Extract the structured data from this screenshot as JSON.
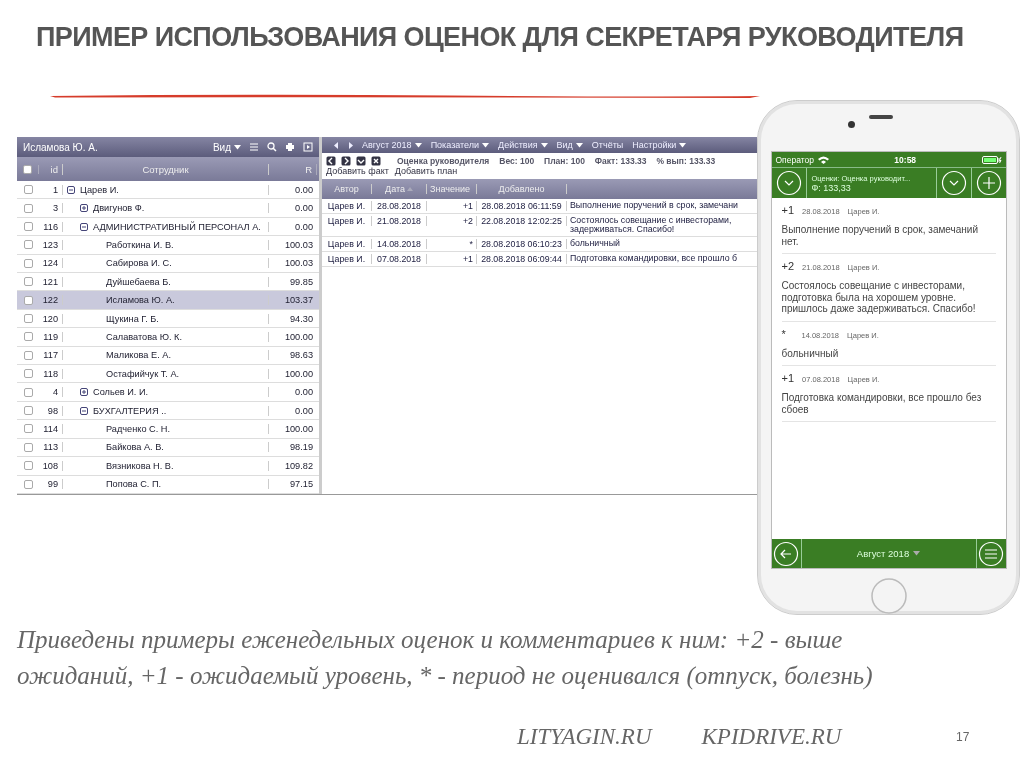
{
  "slide": {
    "title": "ПРИМЕР ИСПОЛЬЗОВАНИЯ ОЦЕНОК ДЛЯ СЕКРЕТАРЯ РУКОВОДИТЕЛЯ",
    "caption": "Приведены примеры еженедельных оценок и комментариев к ним: +2 - выше ожиданий, +1 - ожидаемый уровень, * - период не оценивался (отпуск, болезнь)",
    "footer_links": [
      "LITYAGIN.RU",
      "KPIDRIVE.RU"
    ],
    "page_number": "17"
  },
  "employee_panel": {
    "title": "Исламова Ю. А.",
    "view_menu": "Вид",
    "columns": [
      "id",
      "Сотрудник",
      "R"
    ],
    "all_checked": false,
    "rows": [
      {
        "id": "1",
        "name": "Царев И.",
        "r": "0.00",
        "checked": false,
        "selected": false,
        "expanded": true,
        "children": [
          {
            "id": "3",
            "name": "Двигунов Ф.",
            "r": "0.00",
            "checked": false,
            "selected": false,
            "expanded": false
          },
          {
            "id": "116",
            "name": "АДМИНИСТРАТИВНЫЙ ПЕРСОНАЛ А.",
            "r": "0.00",
            "checked": false,
            "selected": false,
            "expanded": true,
            "children": [
              {
                "id": "123",
                "name": "Работкина И. В.",
                "r": "100.03",
                "checked": false,
                "selected": false
              },
              {
                "id": "124",
                "name": "Сабирова И. С.",
                "r": "100.03",
                "checked": false,
                "selected": false
              },
              {
                "id": "121",
                "name": "Дуйшебаева Б.",
                "r": "99.85",
                "checked": false,
                "selected": false
              },
              {
                "id": "122",
                "name": "Исламова Ю. А.",
                "r": "103.37",
                "checked": false,
                "selected": true
              },
              {
                "id": "120",
                "name": "Щукина Г. Б.",
                "r": "94.30",
                "checked": false,
                "selected": false
              },
              {
                "id": "119",
                "name": "Салаватова Ю. К.",
                "r": "100.00",
                "checked": false,
                "selected": false
              },
              {
                "id": "117",
                "name": "Маликова Е. А.",
                "r": "98.63",
                "checked": false,
                "selected": false
              },
              {
                "id": "118",
                "name": "Остафийчук Т. А.",
                "r": "100.00",
                "checked": false,
                "selected": false
              }
            ]
          },
          {
            "id": "4",
            "name": "Сольев И. И.",
            "r": "0.00",
            "checked": false,
            "selected": false,
            "expanded": false
          },
          {
            "id": "98",
            "name": "БУХГАЛТЕРИЯ ..",
            "r": "0.00",
            "checked": false,
            "selected": false,
            "expanded": true,
            "children": [
              {
                "id": "114",
                "name": "Радченко С. Н.",
                "r": "100.00",
                "checked": false,
                "selected": false
              },
              {
                "id": "113",
                "name": "Байкова А. В.",
                "r": "98.19",
                "checked": false,
                "selected": false
              },
              {
                "id": "108",
                "name": "Вязникова Н. В.",
                "r": "109.82",
                "checked": false,
                "selected": false
              },
              {
                "id": "99",
                "name": "Попова С. П.",
                "r": "97.15",
                "checked": false,
                "selected": false
              }
            ]
          }
        ]
      }
    ]
  },
  "ratings_panel": {
    "menu": [
      {
        "label": "Август 2018",
        "dropdown": true
      },
      {
        "label": "Показатели",
        "dropdown": true
      },
      {
        "label": "Действия",
        "dropdown": true
      },
      {
        "label": "Вид",
        "dropdown": true
      },
      {
        "label": "Отчёты",
        "dropdown": false
      },
      {
        "label": "Настройки",
        "dropdown": true
      }
    ],
    "indicator": {
      "name": "Оценка руководителя",
      "weight": "Вес: 100",
      "plan": "План: 100",
      "fact": "Факт: 133.33",
      "percent": "% вып: 133.33"
    },
    "actions": [
      "Добавить факт",
      "Добавить план"
    ],
    "columns": [
      "Автор",
      "Дата",
      "Значение",
      "Добавлено"
    ],
    "rows": [
      {
        "author": "Царев И.",
        "date": "28.08.2018",
        "value": "+1",
        "added": "28.08.2018 06:11:59",
        "comment": "Выполнение поручений в срок, замечани"
      },
      {
        "author": "Царев И.",
        "date": "21.08.2018",
        "value": "+2",
        "added": "22.08.2018 12:02:25",
        "comment": "Состоялось совещание с инвесторами,\nзадерживаться. Спасибо!"
      },
      {
        "author": "Царев И.",
        "date": "14.08.2018",
        "value": "*",
        "added": "28.08.2018 06:10:23",
        "comment": "больничный"
      },
      {
        "author": "Царев И.",
        "date": "07.08.2018",
        "value": "+1",
        "added": "28.08.2018 06:09:44",
        "comment": "Подготовка командировки, все прошло б"
      }
    ]
  },
  "phone": {
    "carrier": "Оператор",
    "time": "10:58",
    "header_title": "Оценки: Оценка руководит...",
    "header_fact": "Ф: 133,33",
    "items": [
      {
        "value": "+1",
        "date": "28.08.2018",
        "author": "Царев И.",
        "text": "Выполнение поручений в срок, замечаний нет."
      },
      {
        "value": "+2",
        "date": "21.08.2018",
        "author": "Царев И.",
        "text": "Состоялось совещание с инвесторами, подготовка была на хорошем уровне. пришлось даже задерживаться. Спасибо!"
      },
      {
        "value": "*",
        "date": "14.08.2018",
        "author": "Царев И.",
        "text": "больничный"
      },
      {
        "value": "+1",
        "date": "07.08.2018",
        "author": "Царев И.",
        "text": "Подготовка командировки, все прошло без сбоев"
      }
    ],
    "month": "Август 2018"
  }
}
